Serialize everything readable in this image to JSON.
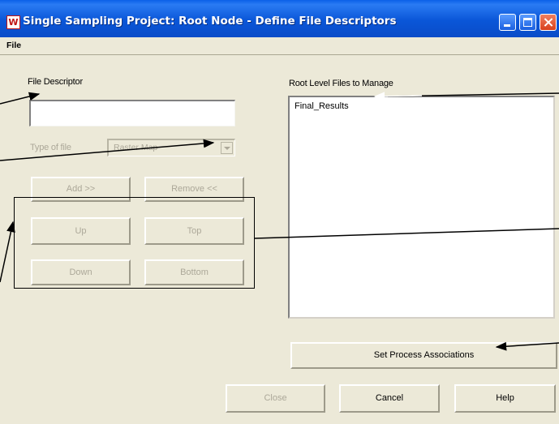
{
  "window": {
    "title": "Single Sampling Project: Root Node - Define File Descriptors",
    "app_icon_letter": "W",
    "controls": [
      "minimize-icon",
      "maximize-icon",
      "close-icon"
    ]
  },
  "menu": {
    "items": [
      "File"
    ]
  },
  "left": {
    "file_descriptor_label": "File Descriptor",
    "file_descriptor_value": "",
    "type_label": "Type of file",
    "type_value": "Raster Map",
    "add_label": "Add >>",
    "remove_label": "Remove <<",
    "up_label": "Up",
    "top_label": "Top",
    "down_label": "Down",
    "bottom_label": "Bottom"
  },
  "right": {
    "list_label": "Root Level Files to Manage",
    "files": [
      "Final_Results"
    ],
    "set_process_label": "Set Process Associations"
  },
  "footer": {
    "close_label": "Close",
    "cancel_label": "Cancel",
    "help_label": "Help"
  },
  "colors": {
    "titlebar": "#0a56d8",
    "dialog_bg": "#ece9d8",
    "disabled_text": "#aca899"
  }
}
